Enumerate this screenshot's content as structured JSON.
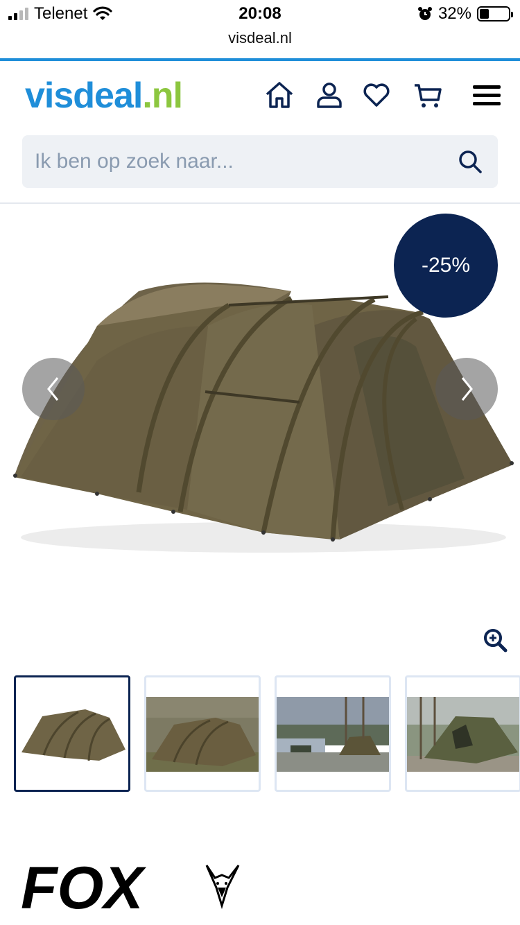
{
  "status_bar": {
    "carrier": "Telenet",
    "time": "20:08",
    "battery_percent": "32%",
    "battery_level": 0.32,
    "signal_bars": 2
  },
  "browser": {
    "url": "visdeal.nl"
  },
  "header": {
    "logo_part1": "visdeal",
    "logo_part2": ".nl",
    "logo_color_1": "#1f8ed9",
    "logo_color_2": "#8cc63f",
    "icons": [
      "home-icon",
      "account-icon",
      "wishlist-heart-icon",
      "cart-icon",
      "menu-hamburger-icon"
    ]
  },
  "search": {
    "placeholder": "Ik ben op zoek naar...",
    "value": "",
    "icon": "search-icon"
  },
  "product": {
    "discount_badge": "-25%",
    "badge_color": "#0c2452",
    "image": "tent-main-image",
    "prev_icon": "chevron-left-icon",
    "next_icon": "chevron-right-icon",
    "zoom_icon": "zoom-in-icon",
    "thumbnails": [
      {
        "name": "thumbnail-tent-studio",
        "active": true
      },
      {
        "name": "thumbnail-tent-lakeside",
        "active": false
      },
      {
        "name": "thumbnail-tent-lake-trees",
        "active": false
      },
      {
        "name": "thumbnail-tent-woods-open",
        "active": false
      }
    ]
  },
  "brand_logo": {
    "text": "FOX"
  }
}
